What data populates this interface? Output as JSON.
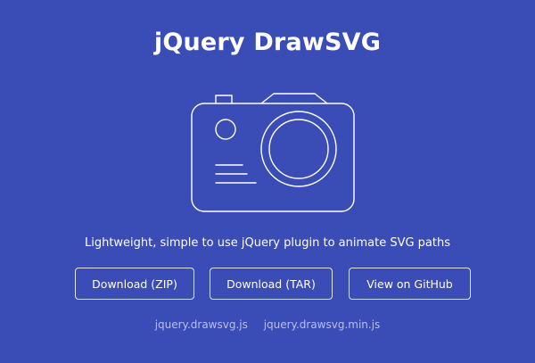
{
  "header": {
    "title": "jQuery DrawSVG"
  },
  "hero": {
    "illustration_icon": "camera-outline-icon",
    "tagline": "Lightweight, simple to use jQuery plugin to animate SVG paths"
  },
  "actions": {
    "download_zip_label": "Download (ZIP)",
    "download_tar_label": "Download (TAR)",
    "github_label": "View on GitHub"
  },
  "files": {
    "full_label": "jquery.drawsvg.js",
    "min_label": "jquery.drawsvg.min.js"
  },
  "colors": {
    "background": "#3a4cb6",
    "text": "#ffffff",
    "link": "#b7c0ee"
  }
}
